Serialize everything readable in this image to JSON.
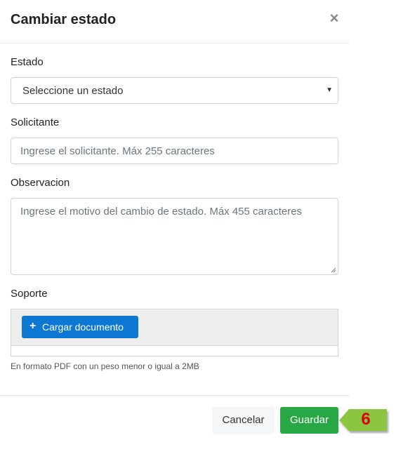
{
  "modal": {
    "title": "Cambiar estado",
    "close_glyph": "×"
  },
  "fields": {
    "estado": {
      "label": "Estado",
      "selected": "Seleccione un estado",
      "caret": "▼"
    },
    "solicitante": {
      "label": "Solicitante",
      "placeholder": "Ingrese el solicitante. Máx 255 caracteres"
    },
    "observacion": {
      "label": "Observacion",
      "placeholder": "Ingrese el motivo del cambio de estado. Máx 455 caracteres"
    },
    "soporte": {
      "label": "Soporte",
      "upload_icon": "+",
      "upload_label": "Cargar documento",
      "help": "En formato PDF con un peso menor o igual a 2MB"
    }
  },
  "footer": {
    "cancel_label": "Cancelar",
    "save_label": "Guardar"
  },
  "callout": {
    "number": "6"
  },
  "colors": {
    "primary": "#0d78d3",
    "success": "#28a745",
    "callout_green": "#8cc63f",
    "callout_number": "#e00000"
  }
}
